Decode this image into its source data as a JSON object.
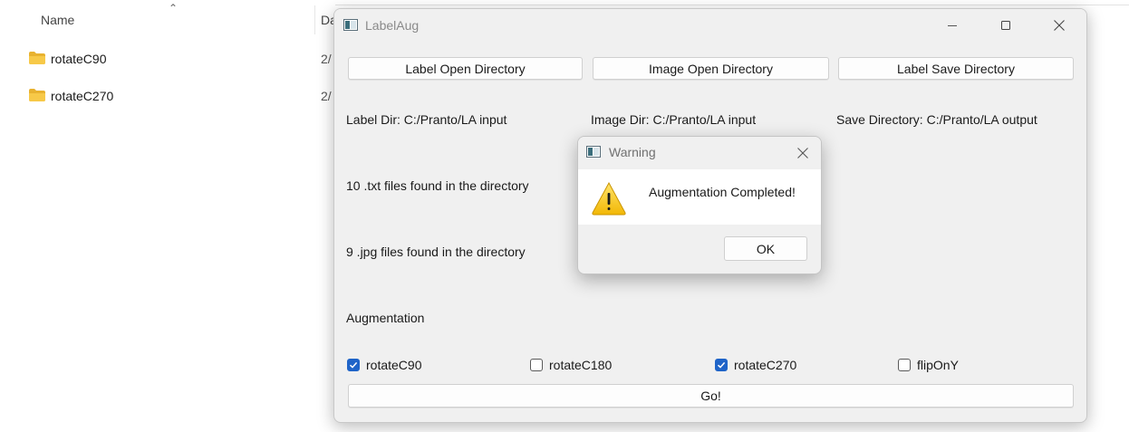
{
  "explorer": {
    "column_name": "Name",
    "column_date": "Da",
    "files": [
      {
        "name": "rotateC90",
        "date": "2/",
        "icon": "folder-icon"
      },
      {
        "name": "rotateC270",
        "date": "2/",
        "icon": "folder-icon"
      }
    ],
    "folder_color": "#f7c948"
  },
  "window": {
    "title": "LabelAug",
    "buttons": {
      "label_open": "Label Open Directory",
      "image_open": "Image Open Directory",
      "label_save": "Label Save Directory",
      "go": "Go!"
    },
    "paths": {
      "label_dir": "Label Dir: C:/Pranto/LA input",
      "image_dir": "Image Dir: C:/Pranto/LA input",
      "save_dir": "Save Directory: C:/Pranto/LA output"
    },
    "txt_count": "10 .txt files found in the directory",
    "jpg_count": "9 .jpg files found in the directory",
    "augmentation_heading": "Augmentation",
    "options": [
      {
        "label": "rotateC90",
        "checked": true
      },
      {
        "label": "rotateC180",
        "checked": false
      },
      {
        "label": "rotateC270",
        "checked": true
      },
      {
        "label": "flipOnY",
        "checked": false
      }
    ],
    "accent_color": "#1f64c8"
  },
  "dialog": {
    "title": "Warning",
    "message": "Augmentation Completed!",
    "ok_label": "OK",
    "icon": "warning-icon"
  }
}
